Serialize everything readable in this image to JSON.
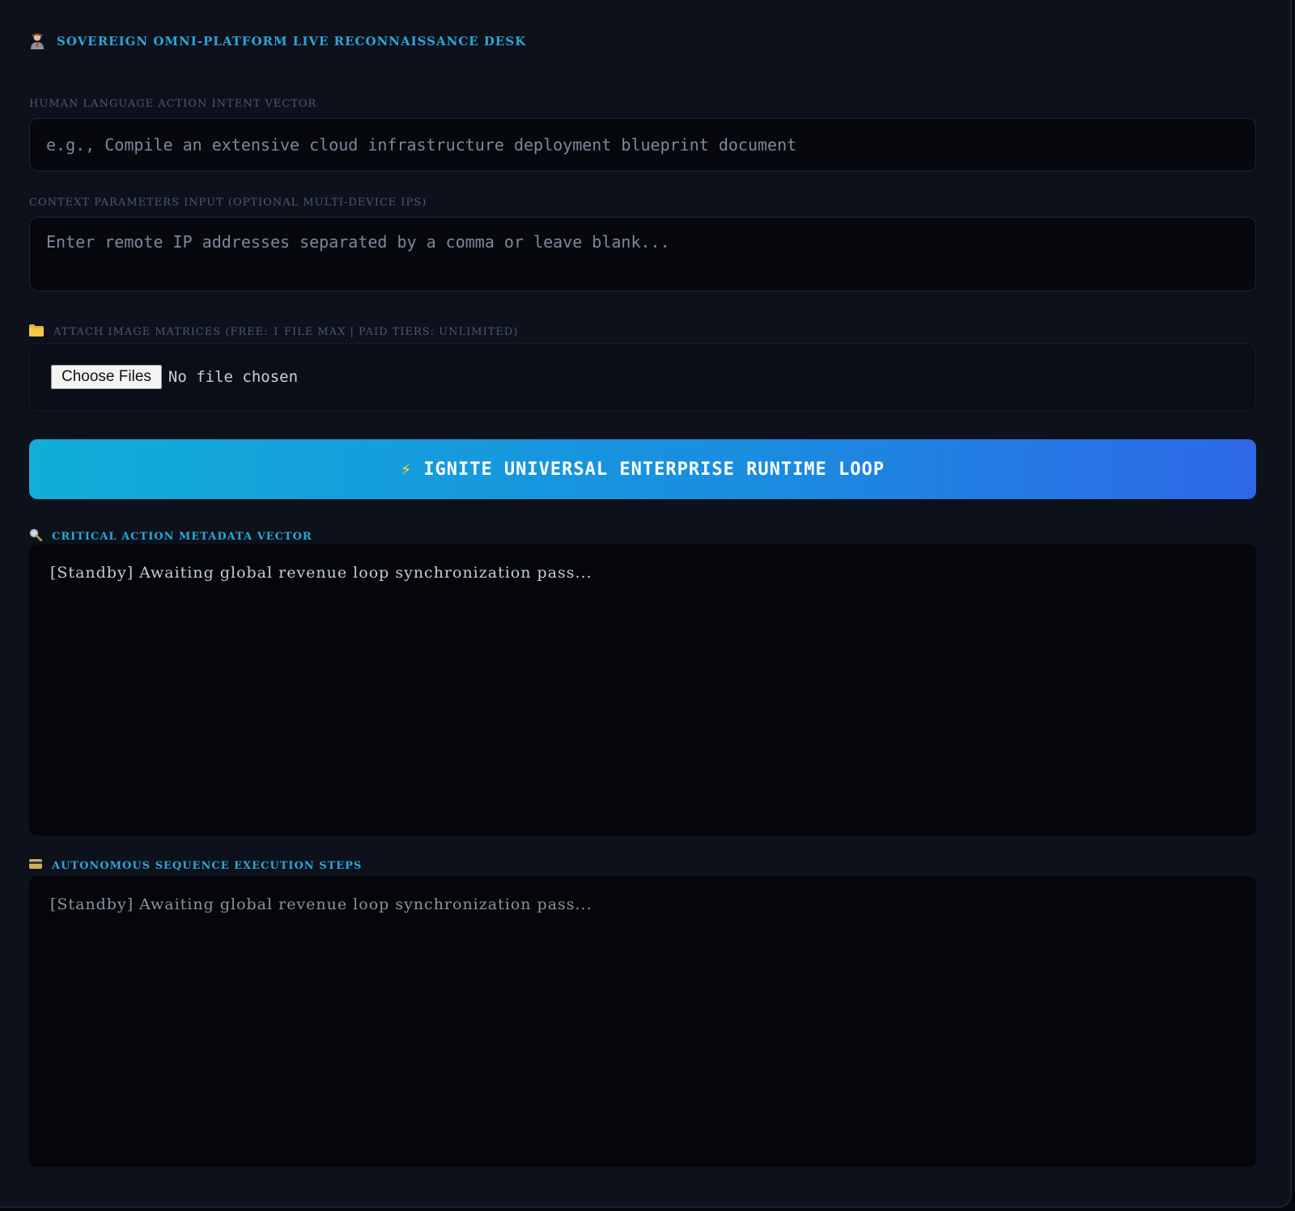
{
  "header": {
    "title": "SOVEREIGN OMNI-PLATFORM LIVE RECONNAISSANCE DESK",
    "icon": "agent-icon"
  },
  "intent": {
    "label": "HUMAN LANGUAGE ACTION INTENT VECTOR",
    "value": "",
    "placeholder": "e.g., Compile an extensive cloud infrastructure deployment blueprint document"
  },
  "context": {
    "label": "CONTEXT PARAMETERS INPUT (OPTIONAL MULTI-DEVICE IPS)",
    "value": "",
    "placeholder": "Enter remote IP addresses separated by a comma or leave blank..."
  },
  "attachments": {
    "label": "ATTACH IMAGE MATRICES (FREE: 1 FILE MAX | PAID TIERS: UNLIMITED)",
    "icon": "folder-icon",
    "button_label": "Choose Files",
    "status": "No file chosen"
  },
  "action": {
    "label": "IGNITE UNIVERSAL ENTERPRISE RUNTIME LOOP",
    "icon": "lightning-icon",
    "icon_glyph": "⚡"
  },
  "metadata": {
    "label": "CRITICAL ACTION METADATA VECTOR",
    "icon": "magnifier-icon",
    "output": "[Standby] Awaiting global revenue loop synchronization pass..."
  },
  "steps": {
    "label": "AUTONOMOUS SEQUENCE EXECUTION STEPS",
    "icon": "card-icon",
    "output": "[Standby] Awaiting global revenue loop synchronization pass..."
  },
  "colors": {
    "background": "#0c111b",
    "accent": "#2aa7d6",
    "button_gradient_start": "#10aed8",
    "button_gradient_end": "#2e68e8"
  }
}
